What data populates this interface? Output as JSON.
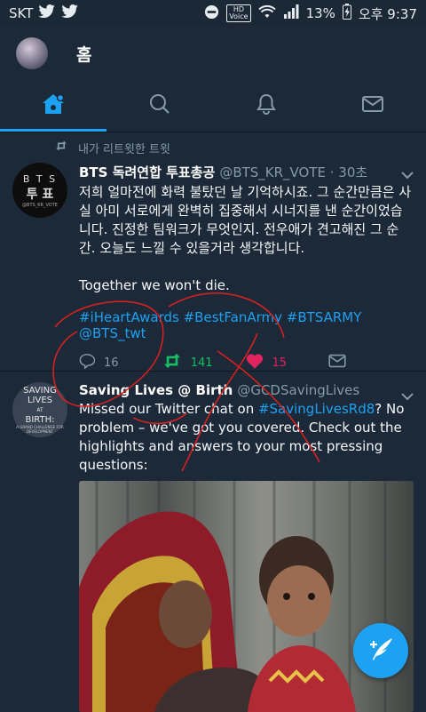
{
  "status_bar": {
    "carrier": "SKT",
    "hd_line1": "HD",
    "hd_line2": "Voice",
    "battery": "13%",
    "time": "오후 9:37"
  },
  "app_bar": {
    "title": "홈"
  },
  "tabs": [
    {
      "icon": "home-icon",
      "active": true
    },
    {
      "icon": "search-icon",
      "active": false
    },
    {
      "icon": "bell-icon",
      "active": false
    },
    {
      "icon": "mail-icon",
      "active": false
    }
  ],
  "tweets": [
    {
      "social_context": "내가 리트윗한 트윗",
      "name": "BTS 독려연합 투표총공",
      "handle": "@BTS_KR_VOTE · 30초",
      "avatar_text": {
        "line1": "B T S",
        "line2": "투 표",
        "line3": "@BTS_KR_VOTE"
      },
      "body": "저희 얼마전에 화력 불탔던 날 기억하시죠. 그 순간만큼은 사실 아미 서로에게 완벽히 집중해서 시너지를 낸 순간이었습니다. 진정한 팀워크가 무엇인지. 전우애가 견고해진 그 순간. 오늘도 느낄 수 있을거라 생각합니다.\n\nTogether we won't die.",
      "tags": "#iHeartAwards #BestFanArmy #BTSARMY @BTS_twt",
      "replies": "16",
      "retweets": "141",
      "likes": "15"
    },
    {
      "name": "Saving Lives @ Birth",
      "handle": "@GCDSavingLives",
      "avatar_text": {
        "line1": "SAVING",
        "line2": "LIVES",
        "line3": "AT",
        "line4": "BIRTH:",
        "line5": "A GRAND CHALLENGE FOR DEVELOPMENT"
      },
      "body_pre": "Missed our Twitter chat on ",
      "body_link": "#SavingLivesRd8",
      "body_post": "? No problem – we've got you covered. Check out the highlights and answers to your most pressing questions:"
    }
  ],
  "colors": {
    "background": "#1c2938",
    "accent": "#1da1f2",
    "retweet": "#17bf63",
    "like": "#e0245e",
    "annotation": "#e0201e"
  }
}
